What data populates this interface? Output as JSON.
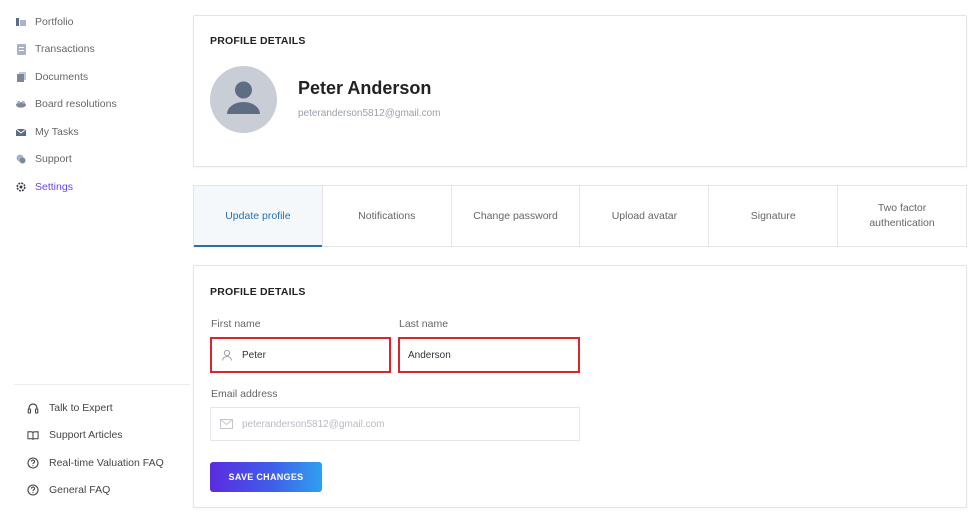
{
  "sidebar": {
    "nav": [
      {
        "label": "Portfolio",
        "icon": "portfolio-icon"
      },
      {
        "label": "Transactions",
        "icon": "transactions-icon"
      },
      {
        "label": "Documents",
        "icon": "documents-icon"
      },
      {
        "label": "Board resolutions",
        "icon": "board-resolutions-icon"
      },
      {
        "label": "My Tasks",
        "icon": "tasks-icon"
      },
      {
        "label": "Support",
        "icon": "support-icon"
      },
      {
        "label": "Settings",
        "icon": "settings-icon",
        "active": true
      }
    ],
    "help": [
      {
        "label": "Talk to Expert",
        "icon": "headphones-icon"
      },
      {
        "label": "Support Articles",
        "icon": "book-icon"
      },
      {
        "label": "Real-time Valuation FAQ",
        "icon": "question-circle-icon"
      },
      {
        "label": "General FAQ",
        "icon": "question-circle-icon"
      }
    ]
  },
  "profile_card": {
    "title": "PROFILE DETAILS",
    "name": "Peter Anderson",
    "email": "peteranderson5812@gmail.com"
  },
  "tabs": [
    {
      "label": "Update profile",
      "active": true
    },
    {
      "label": "Notifications"
    },
    {
      "label": "Change password"
    },
    {
      "label": "Upload avatar"
    },
    {
      "label": "Signature"
    },
    {
      "label": "Two factor authentication"
    }
  ],
  "form": {
    "title": "PROFILE DETAILS",
    "first_name_label": "First name",
    "first_name_value": "Peter",
    "last_name_label": "Last name",
    "last_name_value": "Anderson",
    "email_label": "Email address",
    "email_placeholder": "peteranderson5812@gmail.com",
    "save_label": "SAVE CHANGES"
  },
  "colors": {
    "accent": "#6b46e0",
    "tab_active": "#2a6fa8",
    "highlight_border": "#d8262d"
  }
}
